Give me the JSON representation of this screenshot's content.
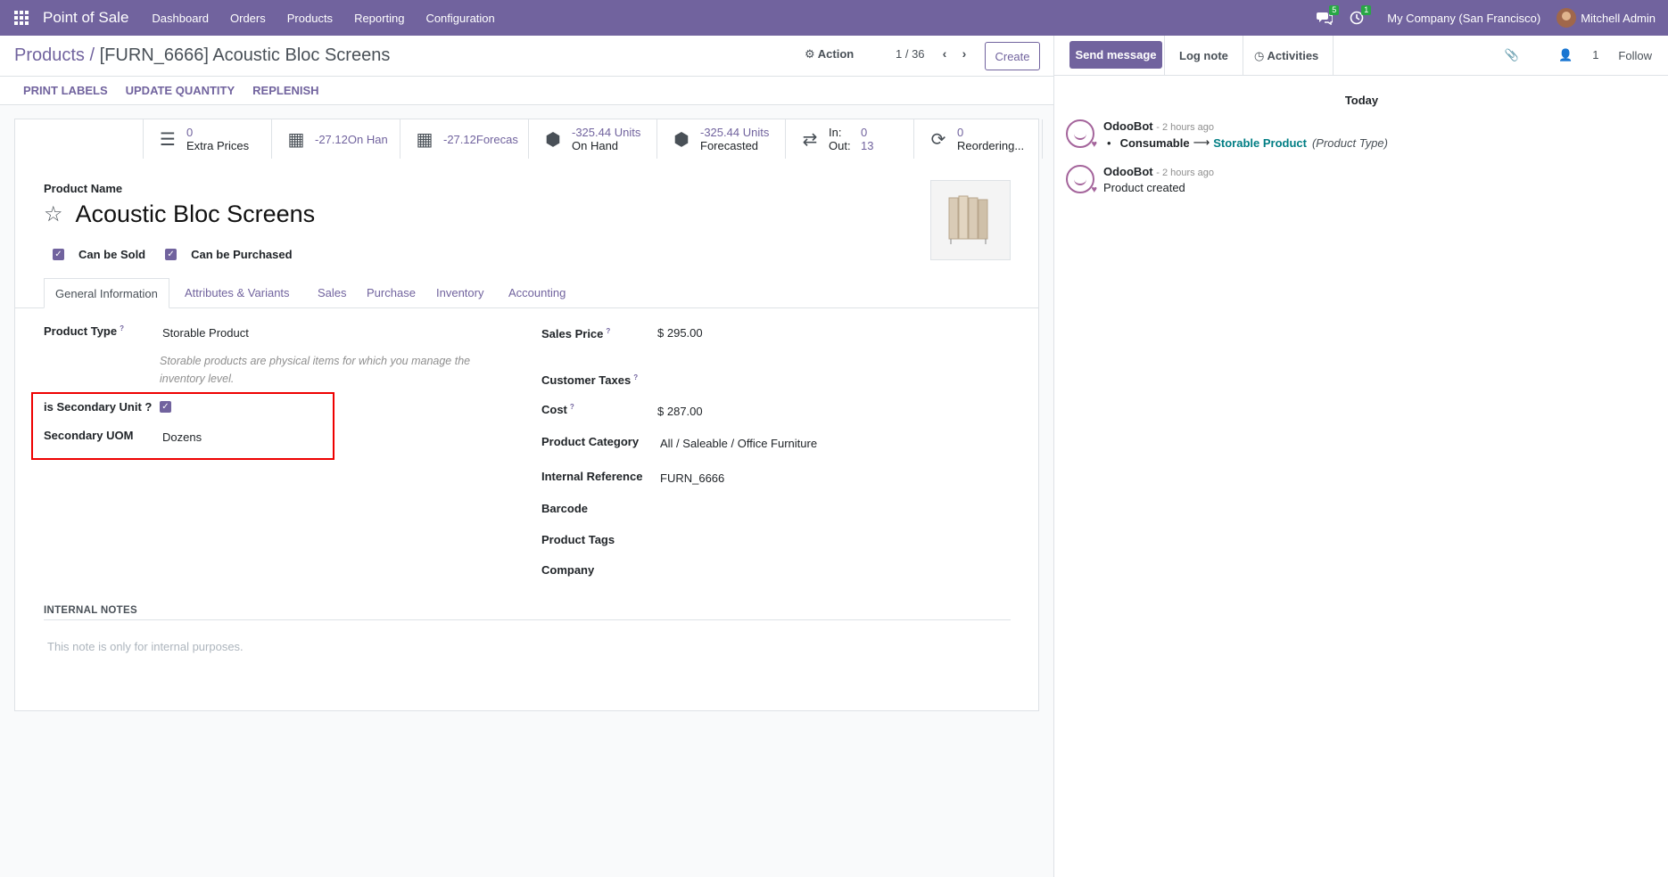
{
  "navbar": {
    "app_name": "Point of Sale",
    "menu": [
      "Dashboard",
      "Orders",
      "Products",
      "Reporting",
      "Configuration"
    ],
    "messages_count": "5",
    "activities_count": "1",
    "company": "My Company (San Francisco)",
    "user": "Mitchell Admin"
  },
  "control": {
    "breadcrumb_parent": "Products",
    "breadcrumb_sep": " / ",
    "breadcrumb_current": "[FURN_6666] Acoustic Bloc Screens",
    "action_label": "Action",
    "pager": "1 / 36",
    "create_label": "Create"
  },
  "statusbar": {
    "buttons": [
      "PRINT LABELS",
      "UPDATE QUANTITY",
      "REPLENISH"
    ]
  },
  "smart_buttons": {
    "extra_prices": {
      "value": "0",
      "label": "Extra Prices"
    },
    "on_hand_short": {
      "value": "-27.12",
      "label": "On Han"
    },
    "forecast_short": {
      "value": "-27.12",
      "label": "Forecas"
    },
    "units_on_hand": {
      "value": "-325.44 Units",
      "label": "On Hand"
    },
    "units_forecasted": {
      "value": "-325.44 Units",
      "label": "Forecasted"
    },
    "in_out": {
      "in_label": "In:",
      "in_value": "0",
      "out_label": "Out:",
      "out_value": "13"
    },
    "reordering": {
      "value": "0",
      "label": "Reordering..."
    }
  },
  "product": {
    "name_label": "Product Name",
    "name": "Acoustic Bloc Screens",
    "can_be_sold": "Can be Sold",
    "can_be_purchased": "Can be Purchased"
  },
  "tabs": [
    "General Information",
    "Attributes & Variants",
    "Sales",
    "Purchase",
    "Inventory",
    "Accounting"
  ],
  "fields_left": {
    "product_type_label": "Product Type",
    "product_type_value": "Storable Product",
    "product_type_hint": "Storable products are physical items for which you manage the inventory level.",
    "secondary_unit_label": "is Secondary Unit ?",
    "secondary_uom_label": "Secondary UOM",
    "secondary_uom_value": "Dozens"
  },
  "fields_right": {
    "sales_price_label": "Sales Price",
    "sales_price_currency": "$",
    "sales_price_value": "295.00",
    "customer_taxes_label": "Customer Taxes",
    "cost_label": "Cost",
    "cost_currency": "$",
    "cost_value": "287.00",
    "category_label": "Product Category",
    "category_value": "All / Saleable / Office Furniture",
    "internal_ref_label": "Internal Reference",
    "internal_ref_value": "FURN_6666",
    "barcode_label": "Barcode",
    "tags_label": "Product Tags",
    "company_label": "Company"
  },
  "notes": {
    "label": "INTERNAL NOTES",
    "placeholder": "This note is only for internal purposes."
  },
  "chatter": {
    "send_message": "Send message",
    "log_note": "Log note",
    "activities": "Activities",
    "followers_count": "1",
    "follow": "Follow",
    "date_sep": "Today",
    "messages": [
      {
        "author": "OdooBot",
        "time": "- 2 hours ago",
        "old_value": "Consumable",
        "new_value": "Storable Product",
        "field": "(Product Type)"
      },
      {
        "author": "OdooBot",
        "time": "- 2 hours ago",
        "body": "Product created"
      }
    ]
  },
  "colors": {
    "brand": "#71639e",
    "link": "#017e84",
    "highlight": "#e00000"
  }
}
